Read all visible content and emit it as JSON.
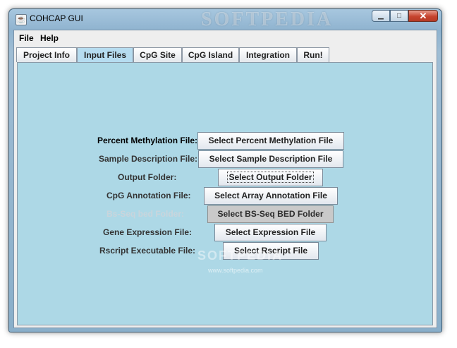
{
  "window": {
    "title": "COHCAP GUI",
    "watermark": "SOFTPEDIA",
    "minimize_glyph": "▁",
    "maximize_glyph": "□",
    "close_glyph": "✕"
  },
  "menubar": {
    "items": [
      {
        "label": "File"
      },
      {
        "label": "Help"
      }
    ]
  },
  "tabs": [
    {
      "label": "Project Info"
    },
    {
      "label": "Input Files",
      "active": true
    },
    {
      "label": "CpG Site"
    },
    {
      "label": "CpG Island"
    },
    {
      "label": "Integration"
    },
    {
      "label": "Run!"
    }
  ],
  "form": {
    "rows": [
      {
        "label": "Percent Methylation File:",
        "button": "Select Percent Methylation File"
      },
      {
        "label": "Sample Description File:",
        "button": "Select Sample Description File"
      },
      {
        "label": "Output Folder:",
        "button": "Select Output Folder"
      },
      {
        "label": "CpG Annotation File:",
        "button": "Select Array Annotation File"
      },
      {
        "label": "Bs-Seq bed Folder:",
        "button": "Select BS-Seq BED Folder",
        "disabled": true
      },
      {
        "label": "Gene Expression File:",
        "button": "Select Expression File"
      },
      {
        "label": "Rscript Executable File:",
        "button": "Select Rscript File"
      }
    ]
  },
  "overlay": {
    "watermark": "SOFTPEDIA",
    "url": "www.softpedia.com"
  }
}
